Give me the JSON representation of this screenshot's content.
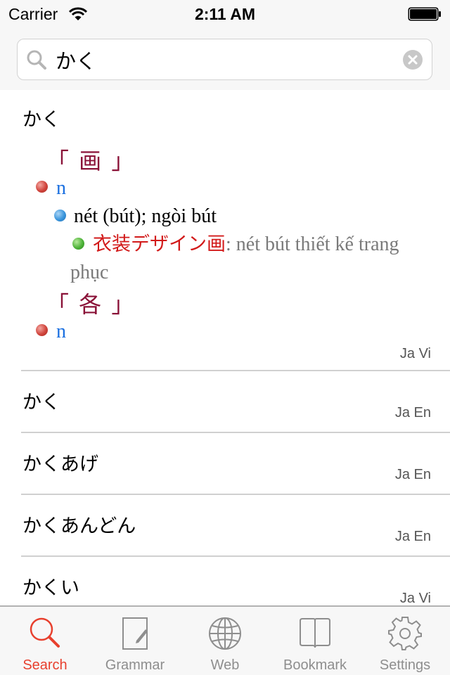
{
  "status_bar": {
    "carrier": "Carrier",
    "time": "2:11 AM",
    "wifi_icon": "wifi-icon",
    "battery_icon": "battery-full-icon"
  },
  "search": {
    "value": "かく",
    "placeholder": "",
    "search_icon": "search-icon",
    "clear_icon": "clear-icon"
  },
  "results": [
    {
      "word": "かく",
      "lang": "Ja Vi",
      "expanded": true,
      "entries": [
        {
          "kanji": "「 画 」",
          "pos": "n",
          "meaning": "nét (bút); ngòi bút",
          "example_ja": "衣装デザイン画",
          "example_vi": ": nét bút thiết kế trang phục"
        },
        {
          "kanji": "「 各 」",
          "pos": "n"
        }
      ]
    },
    {
      "word": "かく",
      "lang": "Ja En"
    },
    {
      "word": "かくあげ",
      "lang": "Ja En"
    },
    {
      "word": "かくあんどん",
      "lang": "Ja En"
    },
    {
      "word": "かくい",
      "lang": "Ja Vi"
    }
  ],
  "colors": {
    "accent": "#e8402e",
    "kanji": "#8a1238",
    "pos": "#1a6fe0",
    "example_ja": "#d21a1a",
    "tab_inactive": "#8e8e8e"
  },
  "tabs": [
    {
      "label": "Search",
      "icon": "search-icon",
      "active": true
    },
    {
      "label": "Grammar",
      "icon": "note-pencil-icon",
      "active": false
    },
    {
      "label": "Web",
      "icon": "globe-icon",
      "active": false
    },
    {
      "label": "Bookmark",
      "icon": "book-icon",
      "active": false
    },
    {
      "label": "Settings",
      "icon": "gear-icon",
      "active": false
    }
  ]
}
